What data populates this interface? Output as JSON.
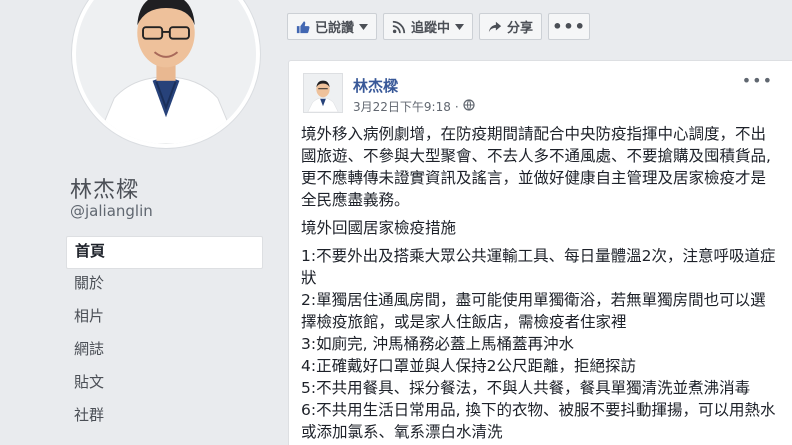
{
  "profile": {
    "name": "林杰樑",
    "handle": "@jalianglin"
  },
  "nav": {
    "items": [
      {
        "label": "首頁",
        "active": true
      },
      {
        "label": "關於",
        "active": false
      },
      {
        "label": "相片",
        "active": false
      },
      {
        "label": "網誌",
        "active": false
      },
      {
        "label": "貼文",
        "active": false
      },
      {
        "label": "社群",
        "active": false
      }
    ]
  },
  "toolbar": {
    "liked_label": "已說讚",
    "following_label": "追蹤中",
    "share_label": "分享",
    "more_label": "•••"
  },
  "post": {
    "author": "林杰樑",
    "timestamp": "3月22日下午9:18",
    "privacy_dot": "·",
    "menu_label": "•••",
    "intro": "境外移入病例劇增，在防疫期間請配合中央防疫指揮中心調度，不出國旅遊、不參與大型聚會、不去人多不通風處、不要搶購及囤積貨品, 更不應轉傳未證實資訊及謠言，並做好健康自主管理及居家檢疫才是全民應盡義務。",
    "section_title": "境外回國居家檢疫措施",
    "items": [
      "1:不要外出及搭乘大眾公共運輸工具、每日量體溫2次，注意呼吸道症狀",
      "2:單獨居住通風房間，盡可能使用單獨衛浴，若無單獨房間也可以選擇檢疫旅館，或是家人住飯店，需檢疫者住家裡",
      "3:如廁完, 沖馬桶務必蓋上馬桶蓋再沖水",
      "4:正確戴好口罩並與人保持2公尺距離，拒絕探訪",
      "5:不共用餐具、採分餐法，不與人共餐，餐具單獨清洗並煮沸消毒",
      "6:不共用生活日常用品, 換下的衣物、被服不要抖動揮揚，可以用熱水或添加氯系、氧系漂白水清洗"
    ]
  },
  "colors": {
    "background": "#e9ebee",
    "link": "#385898",
    "button_bg": "#f5f6f7",
    "like_blue": "#4267b2"
  },
  "icons": [
    "thumbs-up-icon",
    "rss-icon",
    "share-arrow-icon",
    "caret-down-icon",
    "globe-icon"
  ]
}
